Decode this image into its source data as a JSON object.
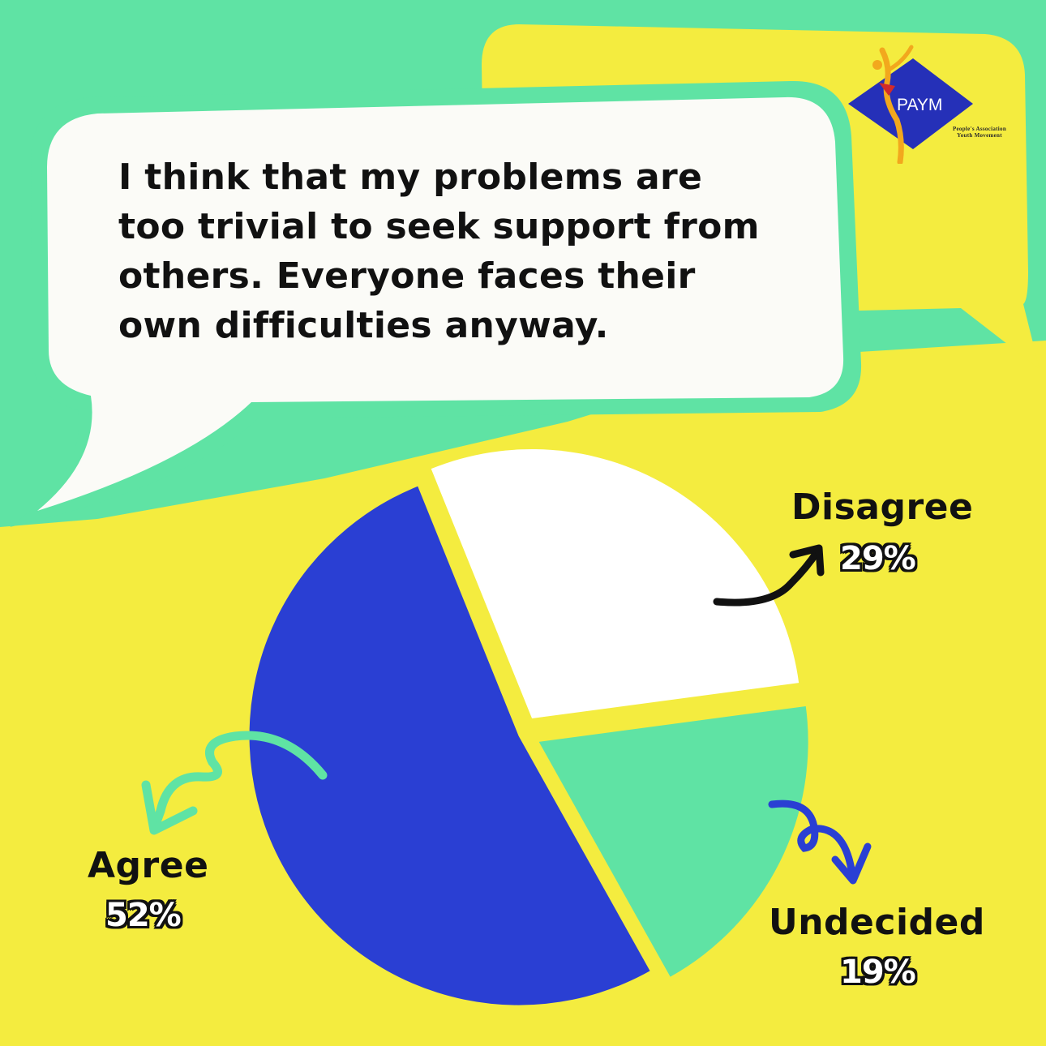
{
  "question": "I think that my problems are\ntoo trivial to seek support from\nothers. Everyone faces their\nown difficulties anyway.",
  "logo": {
    "name": "PAYM",
    "subtitle": "People's Association\nYouth Movement"
  },
  "colors": {
    "background": "#f4ec3f",
    "bubble_outline": "#5fe3a4",
    "bubble_fill": "#fbfbf7",
    "agree": "#2a3fd3",
    "disagree": "#ffffff",
    "undecided": "#5fe3a4"
  },
  "chart_data": {
    "type": "pie",
    "slices": [
      {
        "label": "Agree",
        "value": 52,
        "value_label": "52%",
        "color": "#2a3fd3"
      },
      {
        "label": "Disagree",
        "value": 29,
        "value_label": "29%",
        "color": "#ffffff"
      },
      {
        "label": "Undecided",
        "value": 19,
        "value_label": "19%",
        "color": "#5fe3a4"
      }
    ]
  }
}
